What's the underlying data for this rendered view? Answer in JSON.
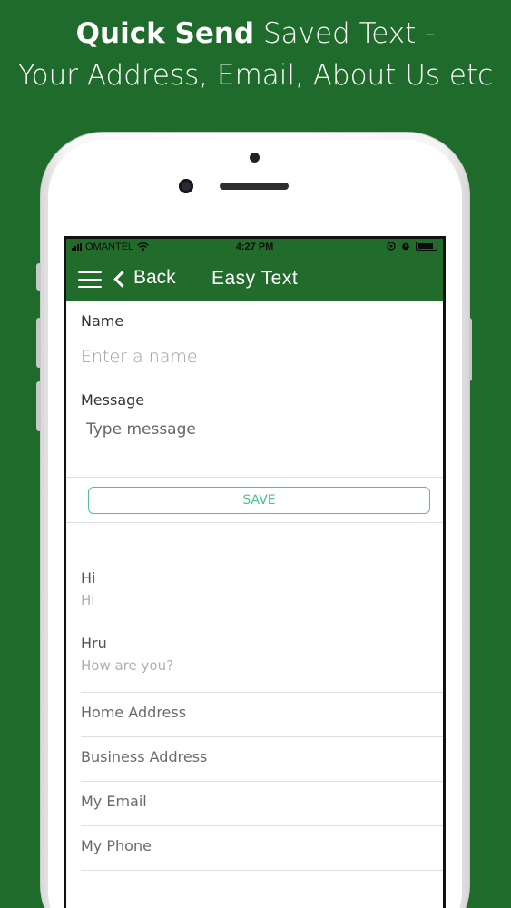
{
  "headline": {
    "bold": "Quick Send",
    "rest_line1": " Saved Text -",
    "line2": "Your Address, Email, About Us etc"
  },
  "status_bar": {
    "carrier": "OMANTEL",
    "time": "4:27 PM"
  },
  "nav": {
    "back_label": "Back",
    "title": "Easy Text"
  },
  "form": {
    "name_label": "Name",
    "name_placeholder": "Enter a name",
    "message_label": "Message",
    "message_placeholder": "Type message",
    "save_label": "SAVE"
  },
  "saved_items": [
    {
      "title": "Hi",
      "subtitle": "Hi"
    },
    {
      "title": "Hru",
      "subtitle": "How are you?"
    },
    {
      "title": "Home Address"
    },
    {
      "title": "Business Address"
    },
    {
      "title": "My Email"
    },
    {
      "title": "My Phone"
    }
  ],
  "colors": {
    "background": "#1f6b2c",
    "nav": "#216b2b",
    "accent": "#52c28a"
  }
}
